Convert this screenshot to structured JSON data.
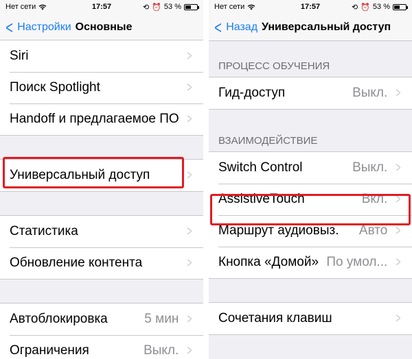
{
  "left": {
    "status": {
      "carrier": "Нет сети",
      "time": "17:57",
      "battery": "53 %",
      "battery_level": 0.53
    },
    "nav": {
      "back": "Настройки",
      "title": "Основные"
    },
    "group1": [
      {
        "label": "Siri"
      },
      {
        "label": "Поиск Spotlight"
      },
      {
        "label": "Handoff и предлагаемое ПО"
      }
    ],
    "group2": [
      {
        "label": "Универсальный доступ"
      }
    ],
    "group3": [
      {
        "label": "Статистика"
      },
      {
        "label": "Обновление контента"
      }
    ],
    "group4": [
      {
        "label": "Автоблокировка",
        "value": "5 мин"
      },
      {
        "label": "Ограничения",
        "value": "Выкл."
      }
    ]
  },
  "right": {
    "status": {
      "carrier": "Нет сети",
      "time": "17:57",
      "battery": "53 %",
      "battery_level": 0.53
    },
    "nav": {
      "back": "Назад",
      "title": "Универсальный доступ"
    },
    "section1_header": "ПРОЦЕСС ОБУЧЕНИЯ",
    "section1": [
      {
        "label": "Гид-доступ",
        "value": "Выкл."
      }
    ],
    "section2_header": "ВЗАИМОДЕЙСТВИЕ",
    "section2": [
      {
        "label": "Switch Control",
        "value": "Выкл."
      },
      {
        "label": "AssistiveTouch",
        "value": "Вкл."
      },
      {
        "label": "Маршрут аудиовыз.",
        "value": "Авто"
      },
      {
        "label": "Кнопка «Домой»",
        "value": "По умол..."
      }
    ],
    "section3": [
      {
        "label": "Сочетания клавиш"
      }
    ]
  },
  "colors": {
    "accent": "#1a7cf5",
    "highlight": "#e21b23"
  }
}
